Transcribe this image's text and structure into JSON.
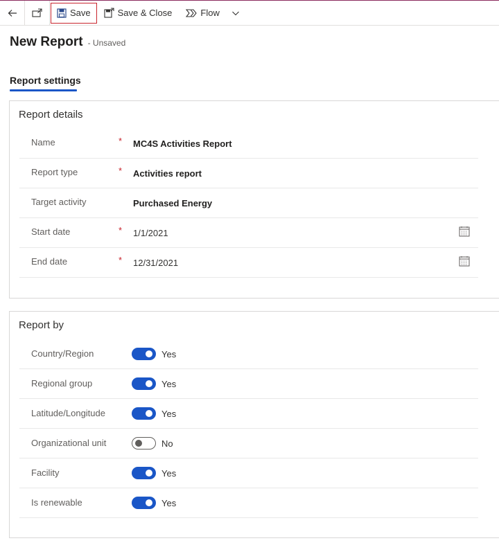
{
  "toolbar": {
    "back_icon": "back-arrow-icon",
    "popout_icon": "open-in-new-window-icon",
    "save_label": "Save",
    "save_close_label": "Save & Close",
    "flow_label": "Flow"
  },
  "header": {
    "title": "New Report",
    "status": "- Unsaved"
  },
  "tabs": [
    {
      "label": "Report settings",
      "active": true
    }
  ],
  "report_details": {
    "title": "Report details",
    "fields": [
      {
        "label": "Name",
        "required": true,
        "value": "MC4S Activities Report"
      },
      {
        "label": "Report type",
        "required": true,
        "value": "Activities report"
      },
      {
        "label": "Target activity",
        "required": false,
        "value": "Purchased Energy"
      },
      {
        "label": "Start date",
        "required": true,
        "value": "1/1/2021"
      },
      {
        "label": "End date",
        "required": true,
        "value": "12/31/2021"
      }
    ]
  },
  "report_by": {
    "title": "Report by",
    "options": [
      {
        "label": "Country/Region",
        "state": "Yes",
        "on": true
      },
      {
        "label": "Regional group",
        "state": "Yes",
        "on": true
      },
      {
        "label": "Latitude/Longitude",
        "state": "Yes",
        "on": true
      },
      {
        "label": "Organizational unit",
        "state": "No",
        "on": false
      },
      {
        "label": "Facility",
        "state": "Yes",
        "on": true
      },
      {
        "label": "Is renewable",
        "state": "Yes",
        "on": true
      }
    ]
  },
  "colors": {
    "accent": "#1a56c7",
    "required": "#c8232c",
    "highlight_border": "#c8232c"
  },
  "required_mark": "*"
}
